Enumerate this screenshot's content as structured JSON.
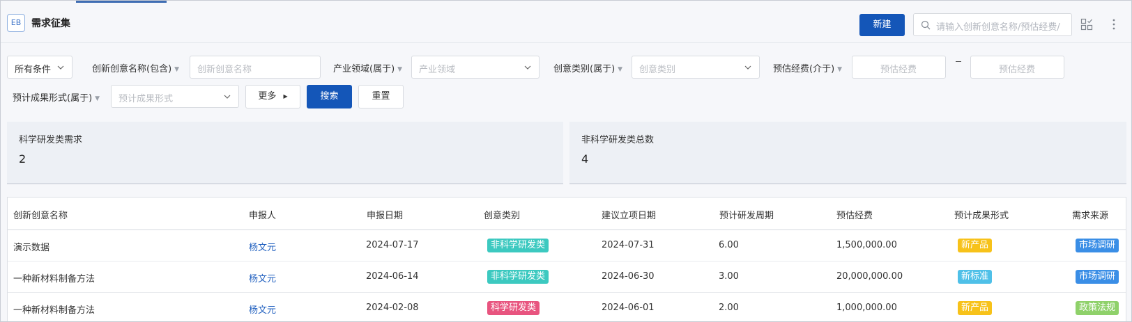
{
  "header": {
    "logo_text": "EB",
    "title": "需求征集",
    "new_button": "新建",
    "search_placeholder": "请输入创新创意名称/预估经费/"
  },
  "filters": {
    "all_conditions": "所有条件",
    "name_label": "创新创意名称(包含)",
    "name_placeholder": "创新创意名称",
    "industry_label": "产业领域(属于)",
    "industry_placeholder": "产业领域",
    "category_label": "创意类别(属于)",
    "category_placeholder": "创意类别",
    "budget_label": "预估经费(介于)",
    "budget_min_placeholder": "预估经费",
    "budget_max_placeholder": "预估经费",
    "outcome_label": "预计成果形式(属于)",
    "outcome_placeholder": "预计成果形式",
    "more_button": "更多",
    "search_button": "搜索",
    "reset_button": "重置"
  },
  "stats": [
    {
      "label": "科学研发类需求",
      "value": "2"
    },
    {
      "label": "非科学研发类总数",
      "value": "4"
    }
  ],
  "table": {
    "columns": [
      "创新创意名称",
      "申报人",
      "申报日期",
      "创意类别",
      "建议立项日期",
      "预计研发周期",
      "预估经费",
      "预计成果形式",
      "需求来源"
    ],
    "rows": [
      {
        "name": "演示数据",
        "applicant": "杨文元",
        "date": "2024-07-17",
        "category": "非科学研发类",
        "category_color": "#3cc9c0",
        "proposal_date": "2024-07-31",
        "cycle": "6.00",
        "budget": "1,500,000.00",
        "outcome": "新产品",
        "outcome_color": "#f7c21a",
        "source": "市场调研",
        "source_color": "#3a8ee6"
      },
      {
        "name": "一种新材料制备方法",
        "applicant": "杨文元",
        "date": "2024-06-14",
        "category": "非科学研发类",
        "category_color": "#3cc9c0",
        "proposal_date": "2024-06-30",
        "cycle": "3.00",
        "budget": "20,000,000.00",
        "outcome": "新标准",
        "outcome_color": "#4fc0e8",
        "source": "市场调研",
        "source_color": "#3a8ee6"
      },
      {
        "name": "一种新材料制备方法",
        "applicant": "杨文元",
        "date": "2024-02-08",
        "category": "科学研发类",
        "category_color": "#e8547f",
        "proposal_date": "2024-06-01",
        "cycle": "2.00",
        "budget": "1,000,000.00",
        "outcome": "新产品",
        "outcome_color": "#f7c21a",
        "source": "政策法规",
        "source_color": "#8fd16a"
      }
    ]
  }
}
